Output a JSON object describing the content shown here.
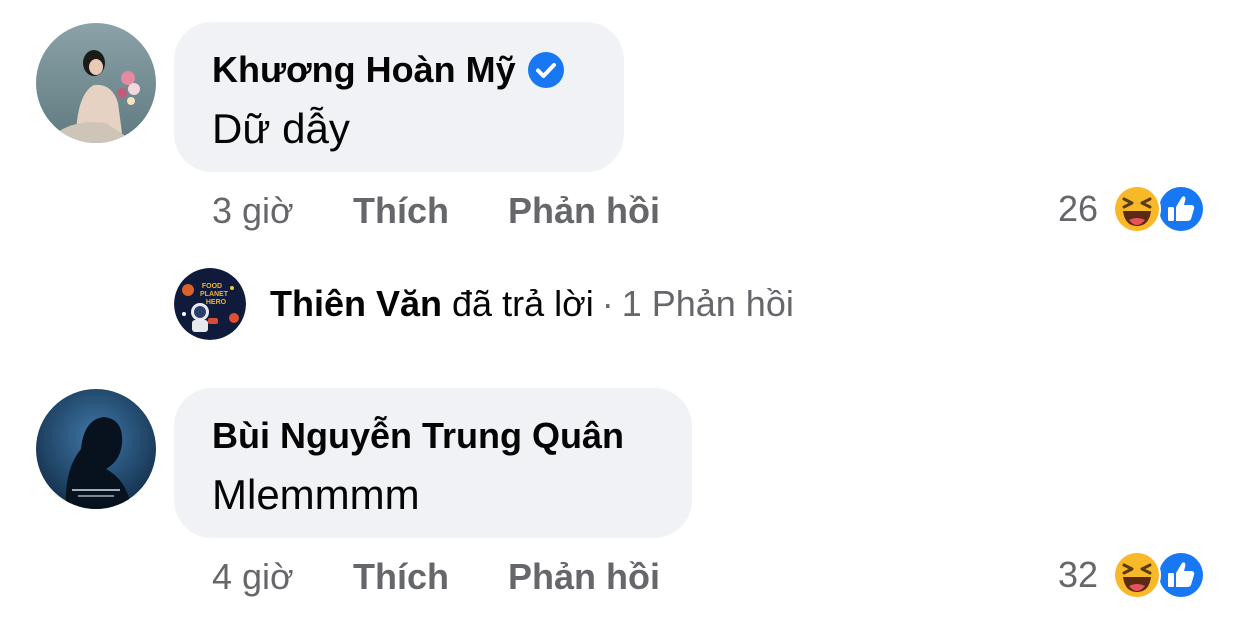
{
  "comments": [
    {
      "author": "Khương Hoàn Mỹ",
      "verified": true,
      "text": "Dữ dẫy",
      "time": "3 giờ",
      "like_label": "Thích",
      "reply_label": "Phản hồi",
      "reaction_count": "26",
      "reactions": [
        "haha-icon",
        "like-icon"
      ]
    },
    {
      "author": "Bùi Nguyễn Trung Quân",
      "verified": false,
      "text": "Mlemmmm",
      "time": "4 giờ",
      "like_label": "Thích",
      "reply_label": "Phản hồi",
      "reaction_count": "32",
      "reactions": [
        "haha-icon",
        "like-icon"
      ]
    }
  ],
  "reply_thread": {
    "author": "Thiên Văn",
    "verb": "đã trả lời",
    "separator": "·",
    "count_label": "1 Phản hồi",
    "avatar_text": [
      "FOOD",
      "PLANET",
      "HERO"
    ]
  },
  "colors": {
    "bubble": "#f0f2f5",
    "secondary_text": "#65676b",
    "verified_blue": "#1877f2",
    "haha_yellow": "#f7b928"
  }
}
